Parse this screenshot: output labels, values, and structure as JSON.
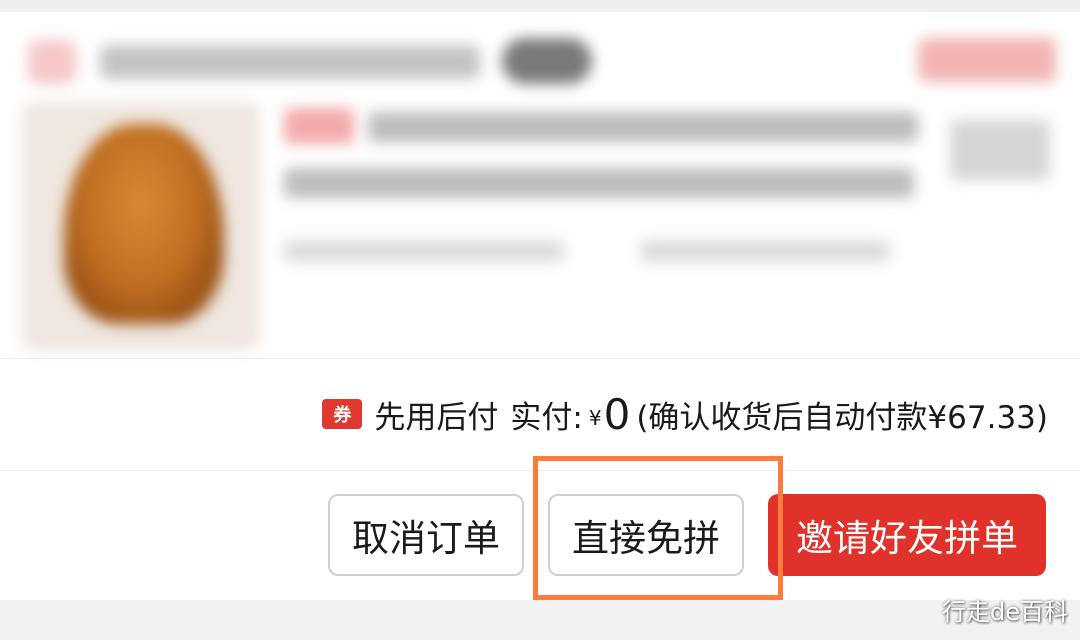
{
  "payment": {
    "coupon_icon_label": "券",
    "method_label": "先用后付",
    "paid_label": "实付:",
    "currency_symbol": "¥",
    "paid_amount": "0",
    "note": "(确认收货后自动付款¥67.33)"
  },
  "actions": {
    "cancel_label": "取消订单",
    "direct_label": "直接免拼",
    "invite_label": "邀请好友拼单"
  },
  "watermark": "行走de百科",
  "colors": {
    "accent_red": "#e0312b",
    "highlight_orange": "#ff7b3d",
    "coupon_red": "#e0372e"
  }
}
